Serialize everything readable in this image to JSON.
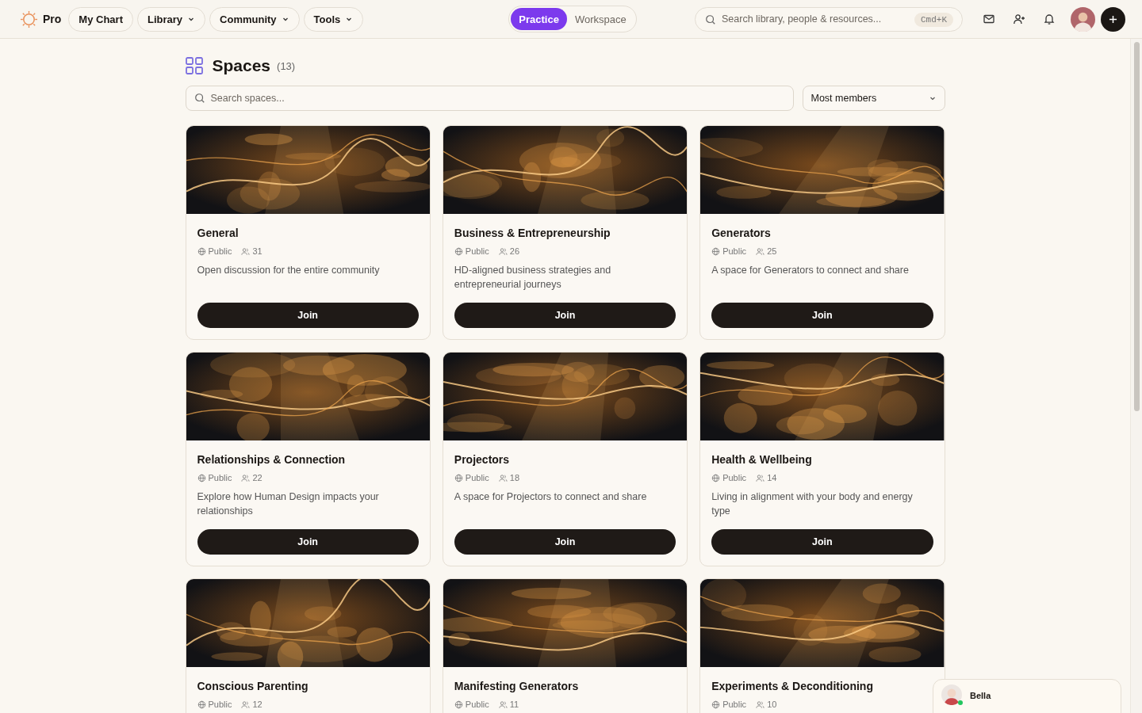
{
  "brand": {
    "label": "Pro"
  },
  "nav": [
    {
      "label": "My Chart",
      "has_menu": false
    },
    {
      "label": "Library",
      "has_menu": true
    },
    {
      "label": "Community",
      "has_menu": true
    },
    {
      "label": "Tools",
      "has_menu": true
    }
  ],
  "modes": [
    {
      "label": "Practice",
      "selected": true
    },
    {
      "label": "Workspace",
      "selected": false
    }
  ],
  "search": {
    "placeholder": "Search library, people & resources...",
    "shortcut": "Cmd+K"
  },
  "page": {
    "title": "Spaces",
    "count": "(13)"
  },
  "space_search": {
    "placeholder": "Search spaces..."
  },
  "sort": {
    "value": "Most members"
  },
  "spaces": [
    {
      "name": "General",
      "visibility": "Public",
      "members": "31",
      "description": "Open discussion for the entire community",
      "button": "Join"
    },
    {
      "name": "Business & Entrepreneurship",
      "visibility": "Public",
      "members": "26",
      "description": "HD-aligned business strategies and entrepreneurial journeys",
      "button": "Join"
    },
    {
      "name": "Generators",
      "visibility": "Public",
      "members": "25",
      "description": "A space for Generators to connect and share",
      "button": "Join"
    },
    {
      "name": "Relationships & Connection",
      "visibility": "Public",
      "members": "22",
      "description": "Explore how Human Design impacts your relationships",
      "button": "Join"
    },
    {
      "name": "Projectors",
      "visibility": "Public",
      "members": "18",
      "description": "A space for Projectors to connect and share",
      "button": "Join"
    },
    {
      "name": "Health & Wellbeing",
      "visibility": "Public",
      "members": "14",
      "description": "Living in alignment with your body and energy type",
      "button": "Join"
    },
    {
      "name": "Conscious Parenting",
      "visibility": "Public",
      "members": "12"
    },
    {
      "name": "Manifesting Generators",
      "visibility": "Public",
      "members": "11"
    },
    {
      "name": "Experiments & Deconditioning",
      "visibility": "Public",
      "members": "10"
    }
  ],
  "chat": {
    "name": "Bella",
    "online": true
  }
}
